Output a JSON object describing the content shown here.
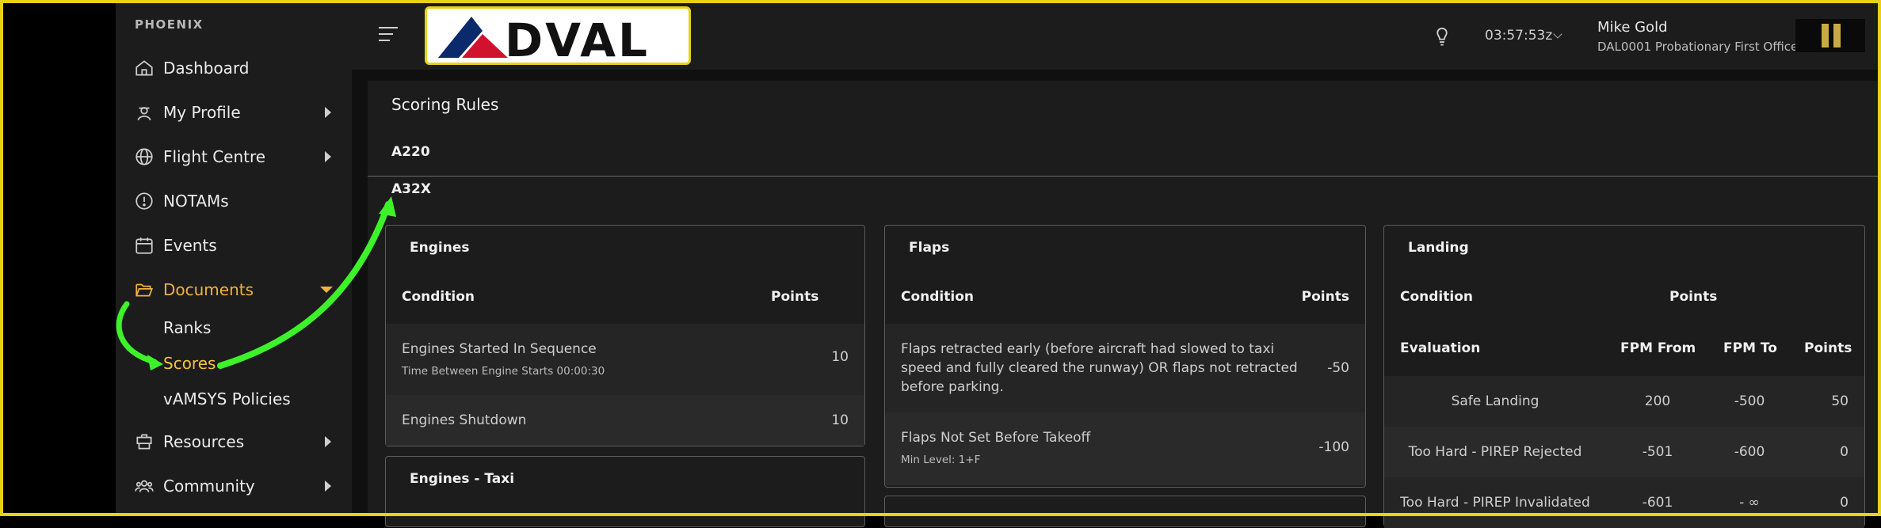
{
  "sidebar": {
    "brand": "PHOENIX",
    "items": [
      {
        "label": "Dashboard"
      },
      {
        "label": "My Profile"
      },
      {
        "label": "Flight Centre"
      },
      {
        "label": "NOTAMs"
      },
      {
        "label": "Events"
      },
      {
        "label": "Documents"
      },
      {
        "label": "Resources"
      },
      {
        "label": "Community"
      }
    ],
    "documents_sub": [
      {
        "label": "Ranks"
      },
      {
        "label": "Scores"
      },
      {
        "label": "vAMSYS Policies"
      }
    ]
  },
  "header": {
    "logo_text": "DVAL",
    "clock": "03:57:53z",
    "user_name": "Mike Gold",
    "user_role": "DAL0001 Probationary First Officer"
  },
  "main": {
    "title": "Scoring Rules",
    "aircraft_tabs": [
      "A220",
      "A32X"
    ],
    "engines": {
      "title": "Engines",
      "col_condition": "Condition",
      "col_points": "Points",
      "rows": [
        {
          "condition": "Engines Started In Sequence",
          "detail": "Time Between Engine Starts 00:00:30",
          "points": "10"
        },
        {
          "condition": "Engines Shutdown",
          "detail": "",
          "points": "10"
        }
      ]
    },
    "engines_taxi": {
      "title": "Engines - Taxi"
    },
    "flaps": {
      "title": "Flaps",
      "col_condition": "Condition",
      "col_points": "Points",
      "rows": [
        {
          "condition_lines": [
            "Flaps retracted early (before aircraft had slowed to taxi",
            "speed and fully cleared the runway) OR flaps not retracted",
            "before parking."
          ],
          "points": "-50"
        },
        {
          "condition": "Flaps Not Set Before Takeoff",
          "detail": "Min Level: 1+F",
          "points": "-100"
        }
      ]
    },
    "landing": {
      "title": "Landing",
      "col_condition": "Condition",
      "col_points": "Points",
      "sub_headers": [
        "Evaluation",
        "FPM From",
        "FPM To",
        "Points"
      ],
      "rows": [
        {
          "evaluation": "Safe Landing",
          "fpm_from": "200",
          "fpm_to": "-500",
          "points": "50"
        },
        {
          "evaluation": "Too Hard - PIREP Rejected",
          "fpm_from": "-501",
          "fpm_to": "-600",
          "points": "0"
        },
        {
          "evaluation": "Too Hard - PIREP Invalidated",
          "fpm_from": "-601",
          "fpm_to": "- ∞",
          "points": "0"
        }
      ]
    }
  },
  "colors": {
    "accent": "#f2b23a",
    "annotation_arrow": "#3df22a",
    "frame": "#e8d217"
  }
}
